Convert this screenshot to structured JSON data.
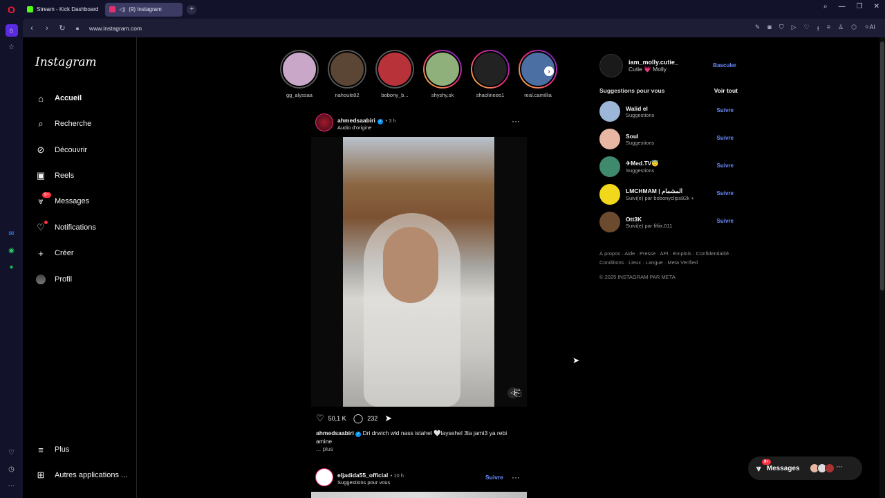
{
  "browser": {
    "tabs": [
      {
        "label": "Stream - Kick Dashboard",
        "color": "#53fc18"
      },
      {
        "label": "(9) Instagram",
        "color": "#e1306c"
      }
    ],
    "url": "www.instagram.com"
  },
  "instagram": {
    "logo": "Instagram",
    "nav": [
      {
        "label": "Accueil",
        "icon": "home-icon"
      },
      {
        "label": "Recherche",
        "icon": "search-icon"
      },
      {
        "label": "Découvrir",
        "icon": "compass-icon"
      },
      {
        "label": "Reels",
        "icon": "reels-icon"
      },
      {
        "label": "Messages",
        "icon": "messenger-icon",
        "badge": "9+"
      },
      {
        "label": "Notifications",
        "icon": "heart-icon"
      },
      {
        "label": "Créer",
        "icon": "plus-icon"
      },
      {
        "label": "Profil",
        "icon": "avatar"
      }
    ],
    "nav_bottom": [
      {
        "label": "Plus",
        "icon": "menu-icon"
      },
      {
        "label": "Autres applications ...",
        "icon": "apps-icon"
      }
    ],
    "stories": [
      {
        "name": "gg_alyssaa",
        "color": "#c9a7c9",
        "live": false
      },
      {
        "name": "nahoule82",
        "color": "#5b4636",
        "live": false
      },
      {
        "name": "bobony_b...",
        "color": "#b8323a",
        "live": false
      },
      {
        "name": "shyshy.sk",
        "color": "#8fb07a",
        "live": true
      },
      {
        "name": "shaolineee1",
        "color": "#222222",
        "live": true
      },
      {
        "name": "real.camillia",
        "color": "#4b6ea3",
        "live": true
      }
    ],
    "post": {
      "username": "ahmedsaabiri",
      "time": "3 h",
      "audio": "Audio d'origine",
      "likes": "50,1 K",
      "comments": "232",
      "caption": "Dri drwich wld nass istahel 🤍laysehel 3la jami3 ya rebi amine",
      "more": "... plus"
    },
    "post2": {
      "username": "eljadida55_official",
      "time": "10 h",
      "sub": "Suggestions pour vous",
      "follow": "Suivre"
    },
    "account": {
      "username": "iam_molly.cutie_",
      "name": "Cutie 💗 Molly",
      "switch": "Basculer"
    },
    "suggestions_title": "Suggestions pour vous",
    "see_all": "Voir tout",
    "suggestions": [
      {
        "name": "Walid el",
        "sub": "Suggestions",
        "color": "#9bb6d8",
        "follow": "Suivre"
      },
      {
        "name": "Soul",
        "sub": "Suggestions",
        "color": "#e7b7a4",
        "follow": "Suivre"
      },
      {
        "name": "✈Med.TV😇",
        "sub": "Suggestions",
        "color": "#3f8a6d",
        "follow": "Suivre"
      },
      {
        "name": "LMCHMAM | المشمام",
        "sub": "Suivi(e) par bobonyclips82k +",
        "color": "#f2d81b",
        "follow": "Suivre"
      },
      {
        "name": "Ott3K",
        "sub": "Suivi(e) par fifiix.011",
        "color": "#6b4a2e",
        "follow": "Suivre"
      }
    ],
    "footer_links": "À propos · Aide · Presse · API · Emplois · Confidentialité · Conditions · Lieux · Langue · Meta Verified",
    "copyright": "© 2025 INSTAGRAM PAR META",
    "messages_bar": {
      "label": "Messages",
      "badge": "9+"
    }
  }
}
